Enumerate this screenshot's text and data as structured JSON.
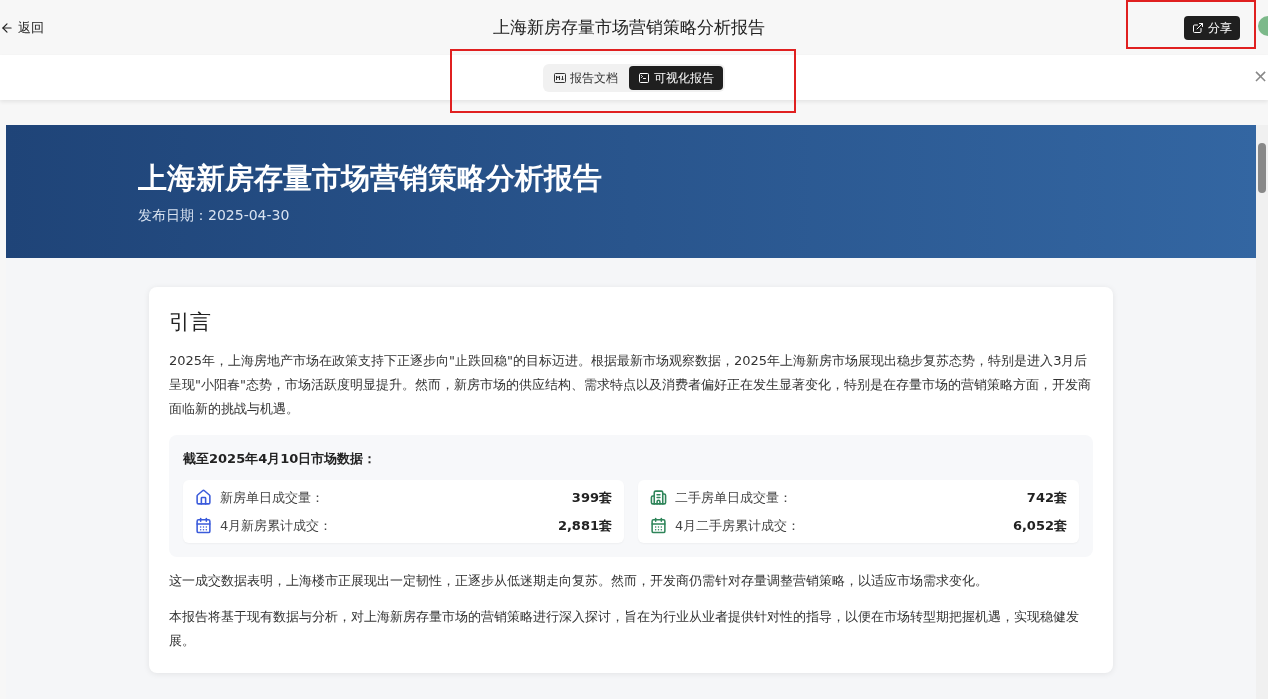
{
  "header": {
    "back": "返回",
    "title": "上海新房存量市场营销策略分析报告",
    "share": "分享"
  },
  "view_tabs": [
    {
      "label": "报告文档",
      "selected": false
    },
    {
      "label": "可视化报告",
      "selected": true
    }
  ],
  "close": "×",
  "report": {
    "title": "上海新房存量市场营销策略分析报告",
    "date": "发布日期：2025-04-30",
    "section_title": "引言",
    "intro": "2025年，上海房地产市场在政策支持下正逐步向\"止跌回稳\"的目标迈进。根据最新市场观察数据，2025年上海新房市场展现出稳步复苏态势，特别是进入3月后呈现\"小阳春\"态势，市场活跃度明显提升。然而，新房市场的供应结构、需求特点以及消费者偏好正在发生显著变化，特别是在存量市场的营销策略方面，开发商面临新的挑战与机遇。",
    "data_box": {
      "title": "截至2025年4月10日市场数据：",
      "groups": [
        {
          "color": "#3b5bdb",
          "rows": [
            {
              "kind": "house",
              "label": "新房单日成交量：",
              "value": "399套"
            },
            {
              "kind": "calendar",
              "label": "4月新房累计成交：",
              "value": "2,881套"
            }
          ]
        },
        {
          "color": "#2f855a",
          "rows": [
            {
              "kind": "building",
              "label": "二手房单日成交量：",
              "value": "742套"
            },
            {
              "kind": "calendar",
              "label": "4月二手房累计成交：",
              "value": "6,052套"
            }
          ]
        }
      ]
    },
    "paragraphs": [
      "这一成交数据表明，上海楼市正展现出一定韧性，正逐步从低迷期走向复苏。然而，开发商仍需针对存量调整营销策略，以适应市场需求变化。",
      "本报告将基于现有数据与分析，对上海新房存量市场的营销策略进行深入探讨，旨在为行业从业者提供针对性的指导，以便在市场转型期把握机遇，实现稳健发展。"
    ]
  }
}
